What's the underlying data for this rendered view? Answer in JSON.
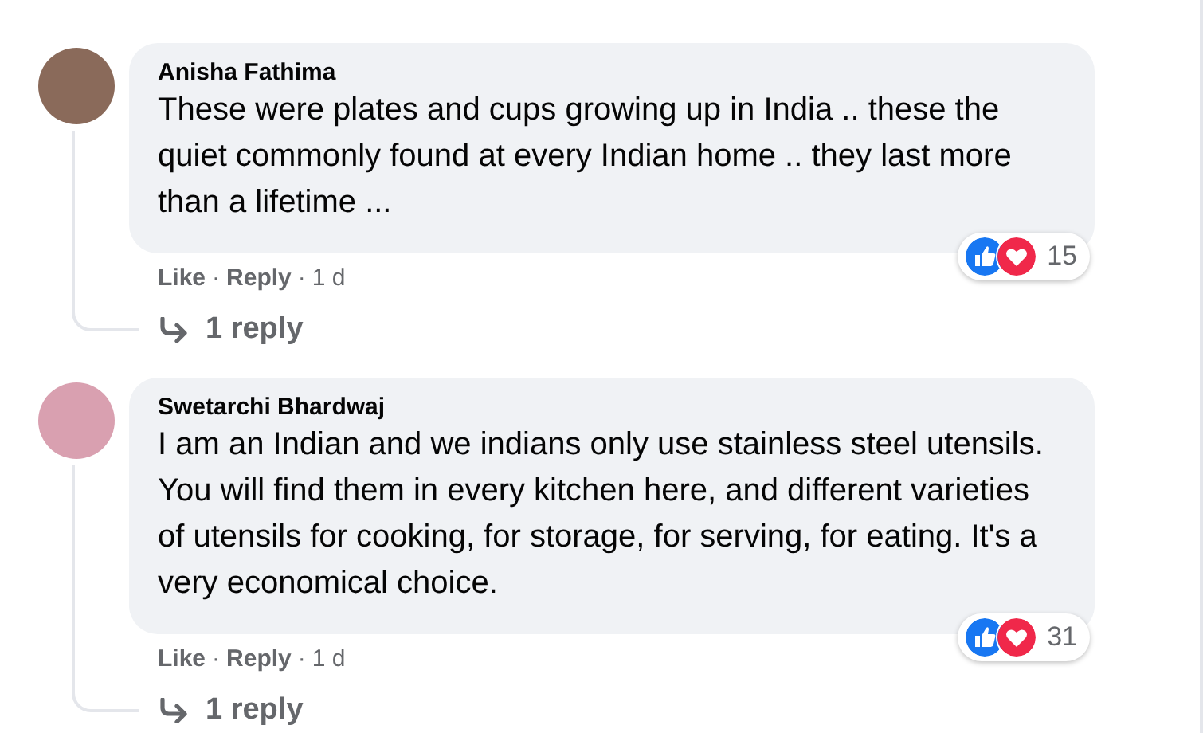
{
  "comments": [
    {
      "author": "Anisha Fathima",
      "text": "These were plates and cups growing up in India .. these the quiet commonly found at every Indian home .. they last more than a lifetime ...",
      "like": "Like",
      "separator": "·",
      "reply": "Reply",
      "time": "1 d",
      "reactions": [
        {
          "kind": "like"
        },
        {
          "kind": "love"
        }
      ],
      "reaction_count": "15",
      "replies_link": "1 reply"
    },
    {
      "author": "Swetarchi Bhardwaj",
      "text": "I am an Indian and we indians only use stainless steel utensils. You will find them in every kitchen here, and different varieties of utensils for cooking, for storage, for serving, for eating. It's a very economical choice.",
      "like": "Like",
      "separator": "·",
      "reply": "Reply",
      "time": "1 d",
      "reactions": [
        {
          "kind": "like"
        },
        {
          "kind": "love"
        }
      ],
      "reaction_count": "31",
      "replies_link": "1 reply"
    }
  ]
}
